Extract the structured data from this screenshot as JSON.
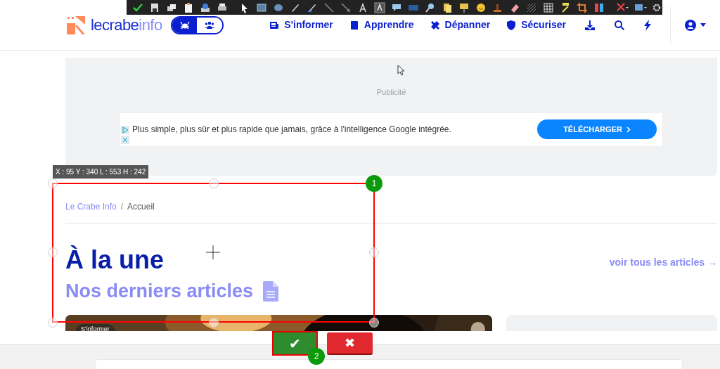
{
  "capture_toolbar": {
    "confirm_label": "✔",
    "cancel_label": "✖",
    "selection_readout": "X : 95 Y : 340 L : 553 H : 242",
    "markers": [
      "1",
      "2"
    ]
  },
  "header": {
    "logo": {
      "part_1": "lecrabe",
      "part_2": "info"
    },
    "audience_toggle": [
      {
        "kind": "crab",
        "selected": true
      },
      {
        "kind": "people",
        "selected": false
      }
    ],
    "nav": [
      {
        "kind": "news",
        "label": "S'informer"
      },
      {
        "kind": "book",
        "label": "Apprendre"
      },
      {
        "kind": "tools",
        "label": "Dépanner"
      },
      {
        "kind": "shield",
        "label": "Sécuriser"
      }
    ]
  },
  "ad": {
    "label": "Publicité",
    "text": "Plus simple, plus sûr et plus rapide que jamais, grâce à l'intelligence Google intégrée.",
    "button": "TÉLÉCHARGER"
  },
  "breadcrumb_separator": "/",
  "breadcrumb": [
    {
      "label": "Le Crabe Info",
      "kind": "link"
    },
    {
      "label": "Accueil",
      "kind": "current"
    }
  ],
  "title": "À la une",
  "subtitle": "Nos derniers articles",
  "see_all": "voir tous les articles →",
  "featured": {
    "tag": "S'informer"
  }
}
